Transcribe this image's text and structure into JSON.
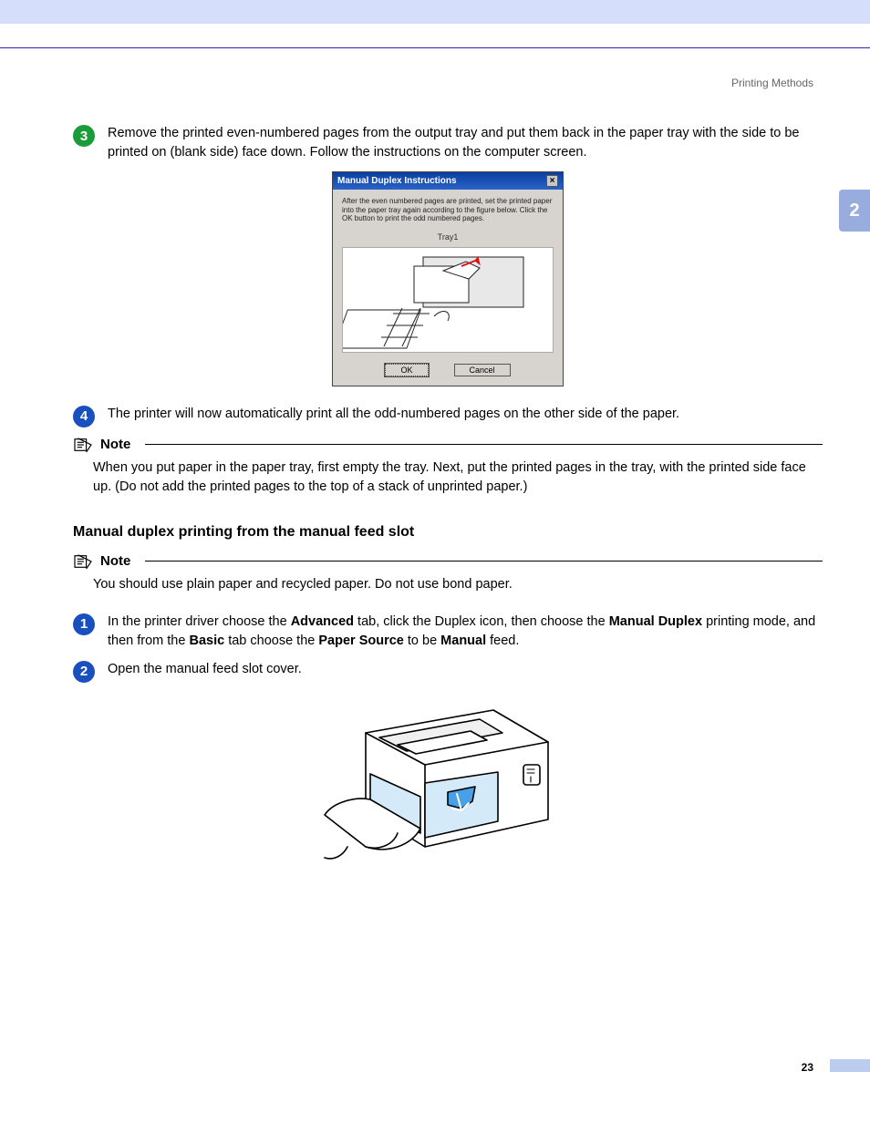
{
  "header": {
    "section": "Printing Methods"
  },
  "side_tab": "2",
  "page_number": "23",
  "steps_a": {
    "s3": {
      "num": "3",
      "text": "Remove the printed even-numbered pages from the output tray and put them back in the paper tray with the side to be printed on (blank side) face down. Follow the instructions on the computer screen."
    },
    "s4": {
      "num": "4",
      "text": "The printer will now automatically print all the odd-numbered pages on the other side of the paper."
    }
  },
  "dialog": {
    "title": "Manual Duplex Instructions",
    "message": "After the even numbered pages are printed, set the printed paper into the paper tray again according to the figure below. Click the OK button to print the odd numbered pages.",
    "tray": "Tray1",
    "ok": "OK",
    "cancel": "Cancel"
  },
  "note1": {
    "label": "Note",
    "body": "When you put paper in the paper tray, first empty the tray. Next, put the printed pages in the tray, with the printed side face up. (Do not add the printed pages to the top of a stack of unprinted paper.)"
  },
  "section_heading": "Manual duplex printing from the manual feed slot",
  "note2": {
    "label": "Note",
    "body": "You should use plain paper and recycled paper. Do not use bond paper."
  },
  "steps_b": {
    "s1": {
      "num": "1",
      "pre": "In the printer driver choose the ",
      "b1": "Advanced",
      "mid1": " tab, click the Duplex icon, then choose the ",
      "b2": "Manual Duplex",
      "mid2": " printing mode, and then from the ",
      "b3": "Basic",
      "mid3": " tab choose the ",
      "b4": "Paper Source",
      "mid4": " to be ",
      "b5": "Manual",
      "post": " feed."
    },
    "s2": {
      "num": "2",
      "text": "Open the manual feed slot cover."
    }
  }
}
